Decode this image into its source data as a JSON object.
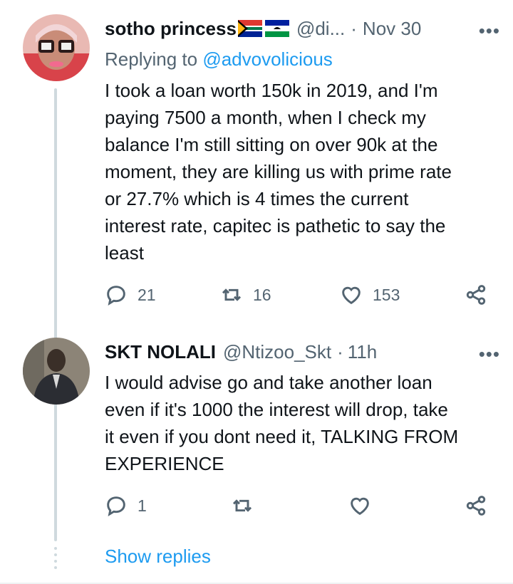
{
  "tweets": [
    {
      "display_name": "sotho princess",
      "handle": "@di...",
      "dot": "·",
      "time": "Nov 30",
      "more": "•••",
      "replying_prefix": "Replying to ",
      "replying_to": "@advovolicious",
      "text_lines": [
        "I took a loan worth 150k in 2019, and I'm",
        "paying 7500 a month, when I check my",
        "balance I'm still sitting on over 90k at the",
        "moment, they are killing us with prime rate",
        "or 27.7% which is 4 times the current",
        "interest rate, capitec is pathetic to say the",
        "least"
      ],
      "replies": "21",
      "retweets": "16",
      "likes": "153"
    },
    {
      "display_name": "SKT NOLALI",
      "handle": "@Ntizoo_Skt",
      "dot": "·",
      "time": "11h",
      "more": "•••",
      "text_lines": [
        "I would advise go and take another loan",
        "even if it's 1000  the interest will drop, take",
        "it even if you dont need it, TALKING FROM",
        "EXPERIENCE"
      ],
      "replies": "1",
      "retweets": "",
      "likes": ""
    }
  ],
  "show_replies": "Show replies",
  "colors": {
    "accent": "#1d9bf0",
    "secondary_text": "#536471",
    "thread_line": "#cfd9de"
  },
  "icons": [
    "reply-icon",
    "retweet-icon",
    "like-icon",
    "share-icon",
    "more-icon",
    "flag-south-africa-icon",
    "flag-lesotho-icon"
  ]
}
